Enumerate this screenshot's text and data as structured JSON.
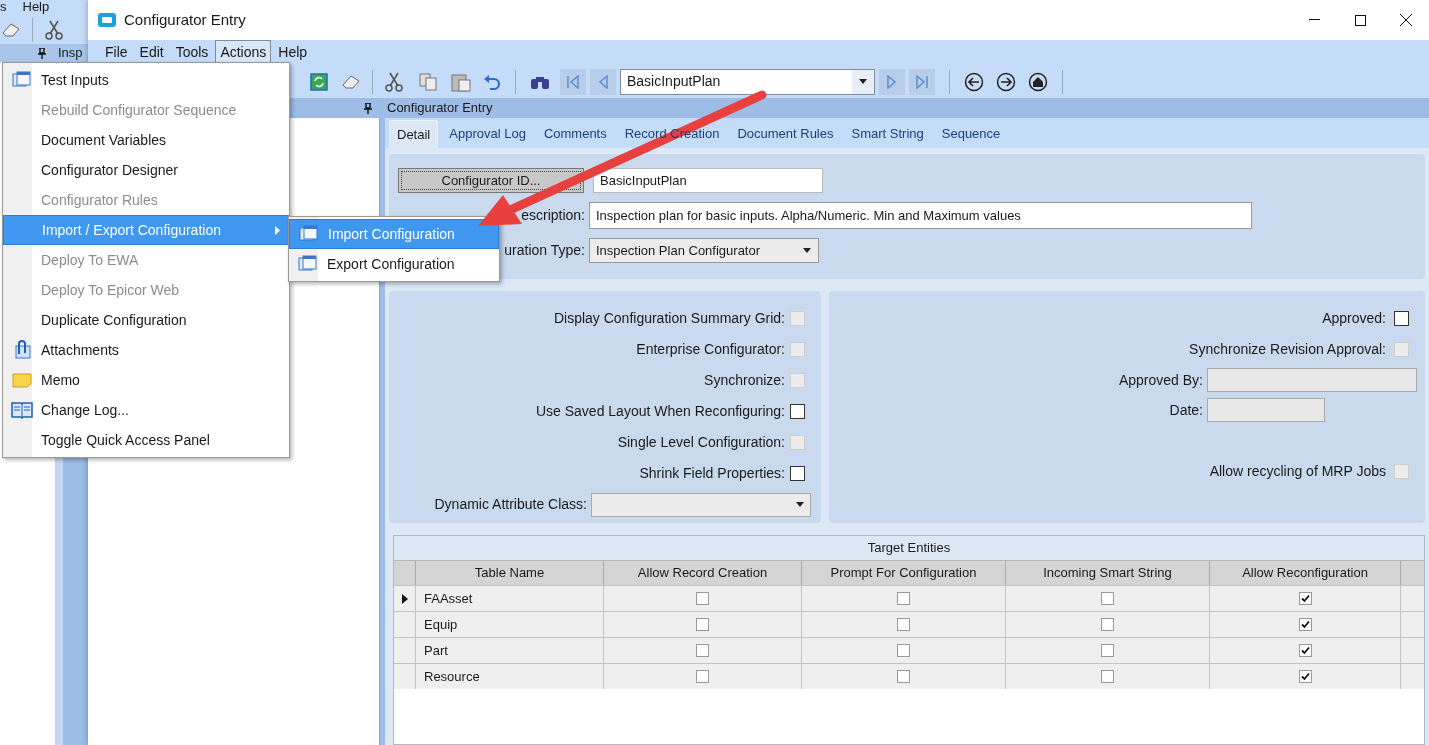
{
  "background_window": {
    "menu_fragment": "s",
    "help_menu": "Help",
    "panel_title": "Insp"
  },
  "window": {
    "title": "Configurator Entry"
  },
  "menu_bar": [
    {
      "label": "File",
      "selected": false
    },
    {
      "label": "Edit",
      "selected": false
    },
    {
      "label": "Tools",
      "selected": false
    },
    {
      "label": "Actions",
      "selected": true
    },
    {
      "label": "Help",
      "selected": false
    }
  ],
  "toolbar": {
    "record_selector": "BasicInputPlan"
  },
  "panel_header": "Configurator Entry",
  "tabs": [
    {
      "label": "Detail",
      "selected": true
    },
    {
      "label": "Approval Log",
      "selected": false
    },
    {
      "label": "Comments",
      "selected": false
    },
    {
      "label": "Record Creation",
      "selected": false
    },
    {
      "label": "Document Rules",
      "selected": false
    },
    {
      "label": "Smart String",
      "selected": false
    },
    {
      "label": "Sequence",
      "selected": false
    }
  ],
  "detail": {
    "configurator_id_button": "Configurator ID...",
    "configurator_id": "BasicInputPlan",
    "description_label": "escription:",
    "description": "Inspection plan for basic inputs. Alpha/Numeric. Min and Maximum values",
    "type_label": "uration Type:",
    "type": "Inspection Plan Configurator"
  },
  "options_left": [
    {
      "kind": "checkbox",
      "label": "Display Configuration Summary Grid:",
      "checked": false,
      "disabled": true
    },
    {
      "kind": "checkbox",
      "label": "Enterprise Configurator:",
      "checked": false,
      "disabled": true
    },
    {
      "kind": "checkbox",
      "label": "Synchronize:",
      "checked": false,
      "disabled": true
    },
    {
      "kind": "checkbox",
      "label": "Use Saved Layout When Reconfiguring:",
      "checked": false,
      "disabled": false
    },
    {
      "kind": "checkbox",
      "label": "Single Level Configuration:",
      "checked": false,
      "disabled": true
    },
    {
      "kind": "checkbox",
      "label": "Shrink Field Properties:",
      "checked": false,
      "disabled": false
    },
    {
      "kind": "dropdown",
      "label": "Dynamic Attribute Class:",
      "disabled": true
    }
  ],
  "options_right": [
    {
      "kind": "checkbox",
      "label": "Approved:",
      "checked": false,
      "disabled": false
    },
    {
      "kind": "checkbox",
      "label": "Synchronize Revision Approval:",
      "checked": false,
      "disabled": true
    },
    {
      "kind": "field",
      "label": "Approved By:",
      "disabled": true
    },
    {
      "kind": "field",
      "label": "Date:",
      "disabled": true
    },
    {
      "kind": "spacer"
    },
    {
      "kind": "checkbox",
      "label": "Allow recycling of MRP Jobs",
      "checked": false,
      "disabled": true
    }
  ],
  "grid": {
    "title": "Target Entities",
    "columns": [
      "Table Name",
      "Allow Record Creation",
      "Prompt For Configuration",
      "Incoming Smart String",
      "Allow Reconfiguration"
    ],
    "rows": [
      {
        "name": "FAAsset",
        "current": true,
        "flags": [
          false,
          false,
          false,
          true
        ]
      },
      {
        "name": "Equip",
        "current": false,
        "flags": [
          false,
          false,
          false,
          true
        ]
      },
      {
        "name": "Part",
        "current": false,
        "flags": [
          false,
          false,
          false,
          true
        ]
      },
      {
        "name": "Resource",
        "current": false,
        "flags": [
          false,
          false,
          false,
          true
        ]
      }
    ]
  },
  "actions_menu": [
    {
      "label": "Test Inputs",
      "disabled": false,
      "selected": false,
      "submenu": false
    },
    {
      "label": "Rebuild Configurator Sequence",
      "disabled": true,
      "selected": false,
      "submenu": false
    },
    {
      "label": "Document Variables",
      "disabled": false,
      "selected": false,
      "submenu": false
    },
    {
      "label": "Configurator Designer",
      "disabled": false,
      "selected": false,
      "submenu": false
    },
    {
      "label": "Configurator Rules",
      "disabled": true,
      "selected": false,
      "submenu": false
    },
    {
      "label": "Import / Export Configuration",
      "disabled": false,
      "selected": true,
      "submenu": true
    },
    {
      "label": "Deploy To EWA",
      "disabled": true,
      "selected": false,
      "submenu": false
    },
    {
      "label": "Deploy To Epicor Web",
      "disabled": true,
      "selected": false,
      "submenu": false
    },
    {
      "label": "Duplicate Configuration",
      "disabled": false,
      "selected": false,
      "submenu": false
    },
    {
      "label": "Attachments",
      "disabled": false,
      "selected": false,
      "submenu": false
    },
    {
      "label": "Memo",
      "disabled": false,
      "selected": false,
      "submenu": false
    },
    {
      "label": "Change Log...",
      "disabled": false,
      "selected": false,
      "submenu": false
    },
    {
      "label": "Toggle Quick Access Panel",
      "disabled": false,
      "selected": false,
      "submenu": false
    }
  ],
  "submenu": [
    {
      "label": "Import Configuration",
      "selected": true
    },
    {
      "label": "Export Configuration",
      "selected": false
    }
  ]
}
